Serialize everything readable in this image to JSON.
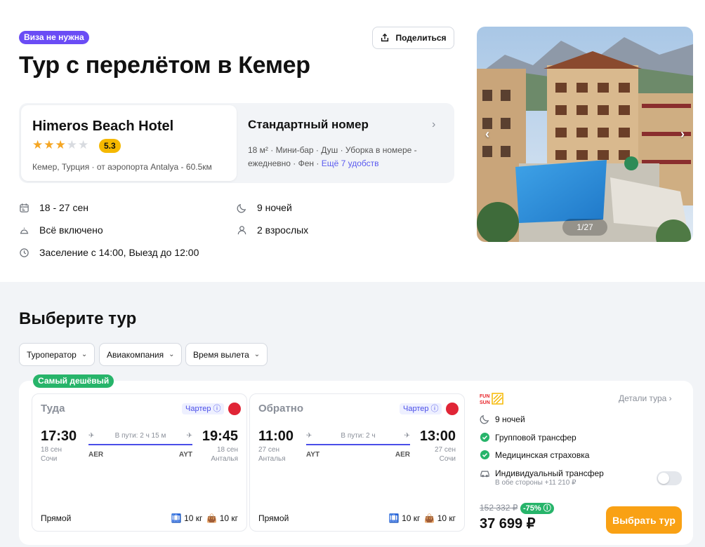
{
  "header": {
    "visa_badge": "Виза не нужна",
    "share_label": "Поделиться",
    "title": "Тур с перелётом в Кемер"
  },
  "hotel": {
    "name": "Himeros Beach Hotel",
    "stars": 3,
    "rating": "5.3",
    "location": "Кемер, Турция · от аэропорта Antalya - 60.5км"
  },
  "room": {
    "title": "Стандартный номер",
    "features": "18 м² · Мини-бар · Душ · Уборка в номере - ежедневно · Фен · ",
    "more_link": "Ещё 7 удобств"
  },
  "trip_info": {
    "dates": "18 - 27 сен",
    "nights": "9 ночей",
    "meal": "Всё включено",
    "guests": "2 взрослых",
    "checkin": "Заселение с 14:00, Выезд до 12:00"
  },
  "gallery": {
    "counter": "1/27"
  },
  "tours": {
    "section_title": "Выберите тур",
    "filters": [
      "Туроператор",
      "Авиакомпания",
      "Время вылета"
    ],
    "cheapest_badge": "Самый дешёвый"
  },
  "flights": {
    "outbound": {
      "label": "Туда",
      "type": "Чартер",
      "dep_time": "17:30",
      "dep_date": "18 сен",
      "dep_city": "Сочи",
      "dep_code": "AER",
      "arr_time": "19:45",
      "arr_date": "18 сен",
      "arr_city": "Анталья",
      "arr_code": "AYT",
      "duration": "В пути: 2 ч 15 м",
      "stops": "Прямой",
      "bag_1": "10 кг",
      "bag_2": "10 кг"
    },
    "return": {
      "label": "Обратно",
      "type": "Чартер",
      "dep_time": "11:00",
      "dep_date": "27 сен",
      "dep_city": "Анталья",
      "dep_code": "AYT",
      "arr_time": "13:00",
      "arr_date": "27 сен",
      "arr_city": "Сочи",
      "arr_code": "AER",
      "duration": "В пути: 2 ч",
      "stops": "Прямой",
      "bag_1": "10 кг",
      "bag_2": "10 кг"
    }
  },
  "offer": {
    "operator_logo": "FUN SUN",
    "details_link": "Детали тура",
    "nights": "9 ночей",
    "group_transfer": "Групповой трансфер",
    "insurance": "Медицинская страховка",
    "individual_transfer": "Индивидуальный трансфер",
    "individual_transfer_sub": "В обе стороны +11 210 ₽",
    "old_price": "152 332 ₽",
    "discount": "-75%",
    "price": "37 699 ₽",
    "select_button": "Выбрать тур"
  },
  "colors": {
    "accent": "#6a4cf5",
    "link": "#5b5bf0",
    "rating": "#f5b800",
    "success": "#27b46a",
    "primary_button": "#f9a114"
  }
}
